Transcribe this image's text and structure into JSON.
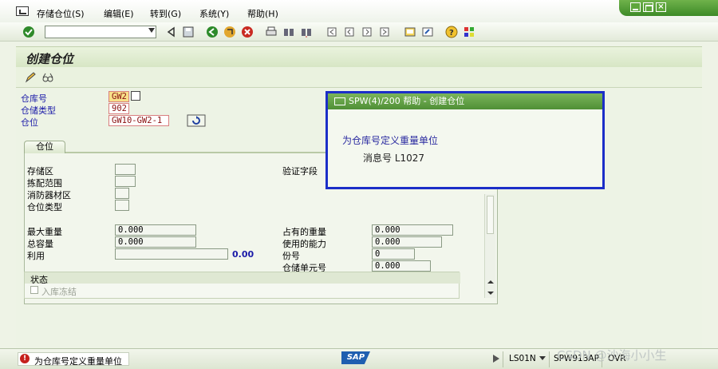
{
  "menubar": {
    "items": [
      {
        "label": "存储仓位(S)"
      },
      {
        "label": "编辑(E)"
      },
      {
        "label": "转到(G)"
      },
      {
        "label": "系统(Y)"
      },
      {
        "label": "帮助(H)"
      }
    ]
  },
  "toolbar": {
    "command_field_value": ""
  },
  "title": "创建仓位",
  "header_fields": {
    "warehouse_label": "仓库号",
    "warehouse_value": "GW2",
    "storage_type_label": "仓储类型",
    "storage_type_value": "902",
    "bin_label": "仓位",
    "bin_value": "GW10-GW2-1"
  },
  "tab": {
    "label": "仓位"
  },
  "panel": {
    "storage_section_label": "存储区",
    "picking_area_label": "拣配范围",
    "fire_area_label": "消防器材区",
    "bin_type_label": "仓位类型",
    "verification_label": "验证字段",
    "max_weight_label": "最大重量",
    "max_weight_value": "0.000",
    "total_capacity_label": "总容量",
    "total_capacity_value": "0.000",
    "utilization_label": "利用",
    "utilization_value": "0.00",
    "occupied_weight_label": "占有的重量",
    "occupied_weight_value": "0.000",
    "used_capacity_label": "使用的能力",
    "used_capacity_value": "0.000",
    "quants_label": "份号",
    "quants_value": "0",
    "storage_units_label": "仓储单元号",
    "storage_units_value": "0.000",
    "status_group_label": "状态",
    "putaway_block_label": "入库冻结"
  },
  "popup": {
    "title": "SPW(4)/200 帮助 - 创建仓位",
    "message": "为仓库号定义重量单位",
    "message_no": "消息号 L1027"
  },
  "statusbar": {
    "message": "为仓库号定义重量单位",
    "sap_logo": "SAP",
    "system": "LS01N",
    "server": "SPW913AP",
    "mode": "OVR"
  },
  "watermark": "CSDN @沙海小小生",
  "colors": {
    "frame_green": "#4f8f36",
    "popup_border": "#1b2ec8",
    "error_red": "#c6201c"
  }
}
